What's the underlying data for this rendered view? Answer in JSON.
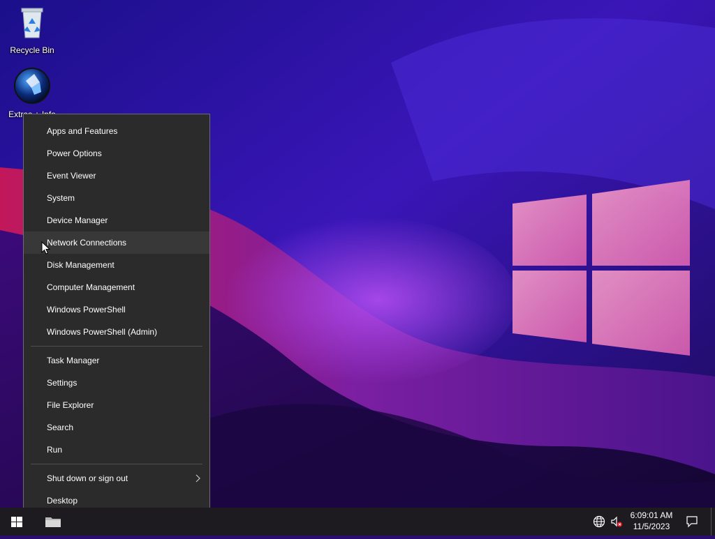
{
  "desktop": {
    "icons": [
      {
        "label": "Recycle Bin",
        "icon": "recycle-bin-icon"
      },
      {
        "label": "Extras + Info",
        "icon": "extras-info-icon"
      }
    ]
  },
  "context_menu": {
    "group1": [
      {
        "label": "Apps and Features"
      },
      {
        "label": "Power Options"
      },
      {
        "label": "Event Viewer"
      },
      {
        "label": "System"
      },
      {
        "label": "Device Manager"
      },
      {
        "label": "Network Connections",
        "highlighted": true
      },
      {
        "label": "Disk Management"
      },
      {
        "label": "Computer Management"
      },
      {
        "label": "Windows PowerShell"
      },
      {
        "label": "Windows PowerShell (Admin)"
      }
    ],
    "group2": [
      {
        "label": "Task Manager"
      },
      {
        "label": "Settings"
      },
      {
        "label": "File Explorer"
      },
      {
        "label": "Search"
      },
      {
        "label": "Run"
      }
    ],
    "group3": [
      {
        "label": "Shut down or sign out",
        "submenu": true
      },
      {
        "label": "Desktop"
      }
    ]
  },
  "taskbar": {
    "start_icon": "windows-logo-icon",
    "pinned": [
      {
        "icon": "file-explorer-icon"
      }
    ],
    "tray": {
      "network_icon": "globe-network-icon",
      "volume_icon": "volume-muted-icon",
      "time": "6:09:01 AM",
      "date": "11/5/2023",
      "notification_icon": "action-center-icon"
    }
  },
  "colors": {
    "menu_bg": "#2b2b2b",
    "menu_highlight": "#383838",
    "taskbar_bg": "#1d1b1f",
    "wallpaper_logo": "#e774b4"
  }
}
